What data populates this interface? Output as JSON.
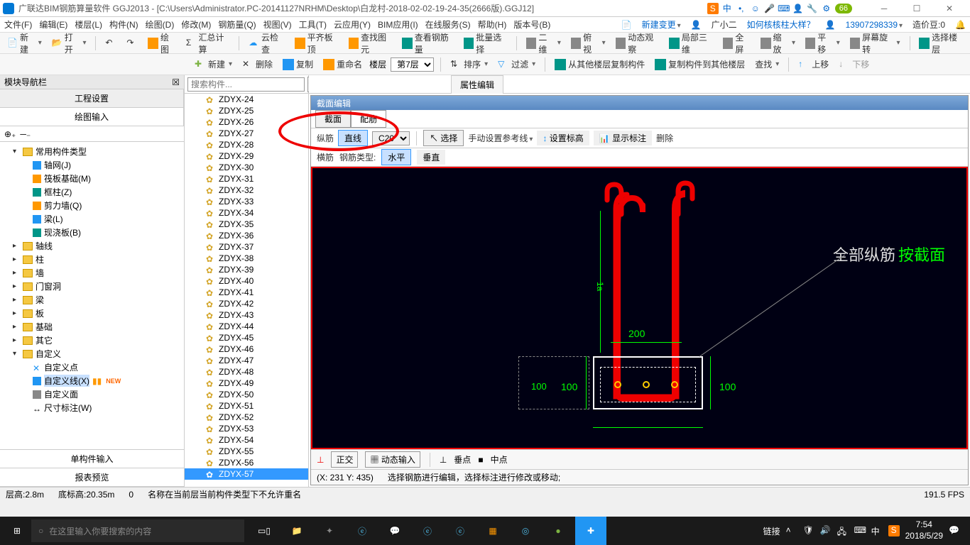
{
  "titlebar": {
    "title": "广联达BIM钢筋算量软件 GGJ2013 - [C:\\Users\\Administrator.PC-20141127NRHM\\Desktop\\白龙村-2018-02-02-19-24-35(2666版).GGJ12]",
    "ime_s": "S",
    "ime_zhong": "中",
    "badge": "66"
  },
  "menu": {
    "items": [
      "文件(F)",
      "编辑(E)",
      "楼层(L)",
      "构件(N)",
      "绘图(D)",
      "修改(M)",
      "钢筋量(Q)",
      "视图(V)",
      "工具(T)",
      "云应用(Y)",
      "BIM应用(I)",
      "在线服务(S)",
      "帮助(H)",
      "版本号(B)"
    ],
    "new_change": "新建变更",
    "guangxiaoer": "广小二",
    "help_link": "如何核核柱大样？",
    "user_id": "13907298339",
    "coin_label": "造价豆:0"
  },
  "toolbar1": {
    "new": "新建",
    "open": "打开",
    "draw": "绘图",
    "sum": "汇总计算",
    "cloud": "云检查",
    "flat": "平齐板顶",
    "find": "查找图元",
    "steel": "查看钢筋量",
    "batch": "批量选择",
    "view2d": "二维",
    "bird": "俯视",
    "dyn": "动态观察",
    "local3d": "局部三维",
    "full": "全屏",
    "zoom": "缩放",
    "pan": "平移",
    "rotate": "屏幕旋转",
    "select_floor": "选择楼层"
  },
  "toolbar2": {
    "new": "新建",
    "del": "删除",
    "copy": "复制",
    "rename": "重命名",
    "floor_label": "楼层",
    "floor_sel": "第7层",
    "sort": "排序",
    "filter": "过滤",
    "copy_from": "从其他楼层复制构件",
    "copy_to": "复制构件到其他楼层",
    "find": "查找",
    "up": "上移",
    "down": "下移"
  },
  "left_panel": {
    "header": "模块导航栏",
    "tab1": "工程设置",
    "tab2": "绘图输入",
    "tree": {
      "root": "常用构件类型",
      "axis": "轴网(J)",
      "raft": "筏板基础(M)",
      "col": "框柱(Z)",
      "shear": "剪力墙(Q)",
      "beam": "梁(L)",
      "slab": "现浇板(B)",
      "n_axis": "轴线",
      "n_col": "柱",
      "n_wall": "墙",
      "n_open": "门窗洞",
      "n_beam": "梁",
      "n_slab": "板",
      "n_found": "基础",
      "n_other": "其它",
      "n_custom": "自定义",
      "c_point": "自定义点",
      "c_line": "自定义线(X)",
      "c_face": "自定义面",
      "c_dim": "尺寸标注(W)"
    },
    "bottom1": "单构件输入",
    "bottom2": "报表预览"
  },
  "mid_panel": {
    "search_ph": "搜索构件...",
    "items": [
      "ZDYX-24",
      "ZDYX-25",
      "ZDYX-26",
      "ZDYX-27",
      "ZDYX-28",
      "ZDYX-29",
      "ZDYX-30",
      "ZDYX-31",
      "ZDYX-32",
      "ZDYX-33",
      "ZDYX-34",
      "ZDYX-35",
      "ZDYX-36",
      "ZDYX-37",
      "ZDYX-38",
      "ZDYX-39",
      "ZDYX-40",
      "ZDYX-41",
      "ZDYX-42",
      "ZDYX-43",
      "ZDYX-44",
      "ZDYX-45",
      "ZDYX-46",
      "ZDYX-47",
      "ZDYX-48",
      "ZDYX-49",
      "ZDYX-50",
      "ZDYX-51",
      "ZDYX-52",
      "ZDYX-53",
      "ZDYX-54",
      "ZDYX-55",
      "ZDYX-56",
      "ZDYX-57"
    ],
    "selected": "ZDYX-57"
  },
  "editor": {
    "prop_tab": "属性编辑",
    "header": "截面编辑",
    "tab1": "截面",
    "tab2": "配筋",
    "row1": {
      "label1": "纵筋",
      "btn_line": "直线",
      "c20": "C20",
      "select": "选择",
      "manual": "手动设置参考线",
      "height": "设置标高",
      "show": "显示标注",
      "del": "删除"
    },
    "row2": {
      "label1": "横筋",
      "label2": "钢筋类型:",
      "horiz": "水平",
      "vert": "垂直"
    },
    "canvas": {
      "label1": "全部纵筋",
      "label2": "按截面",
      "d200": "200",
      "d100a": "100",
      "d100b": "100",
      "d100c": "100",
      "d1a": "1a"
    },
    "footer": {
      "ortho": "正交",
      "dyn": "动态输入",
      "snap1": "垂点",
      "snap2": "中点"
    },
    "status": {
      "coords": "(X: 231 Y: 435)",
      "msg": "选择钢筋进行编辑，选择标注进行修改或移动;"
    }
  },
  "statusbar": {
    "floor_h": "层高:2.8m",
    "bottom_h": "底标高:20.35m",
    "zero": "0",
    "msg": "名称在当前层当前构件类型下不允许重名",
    "fps": "191.5 FPS"
  },
  "taskbar": {
    "search_ph": "在这里输入你要搜索的内容",
    "tray_link": "链接",
    "time": "7:54",
    "date": "2018/5/29"
  }
}
